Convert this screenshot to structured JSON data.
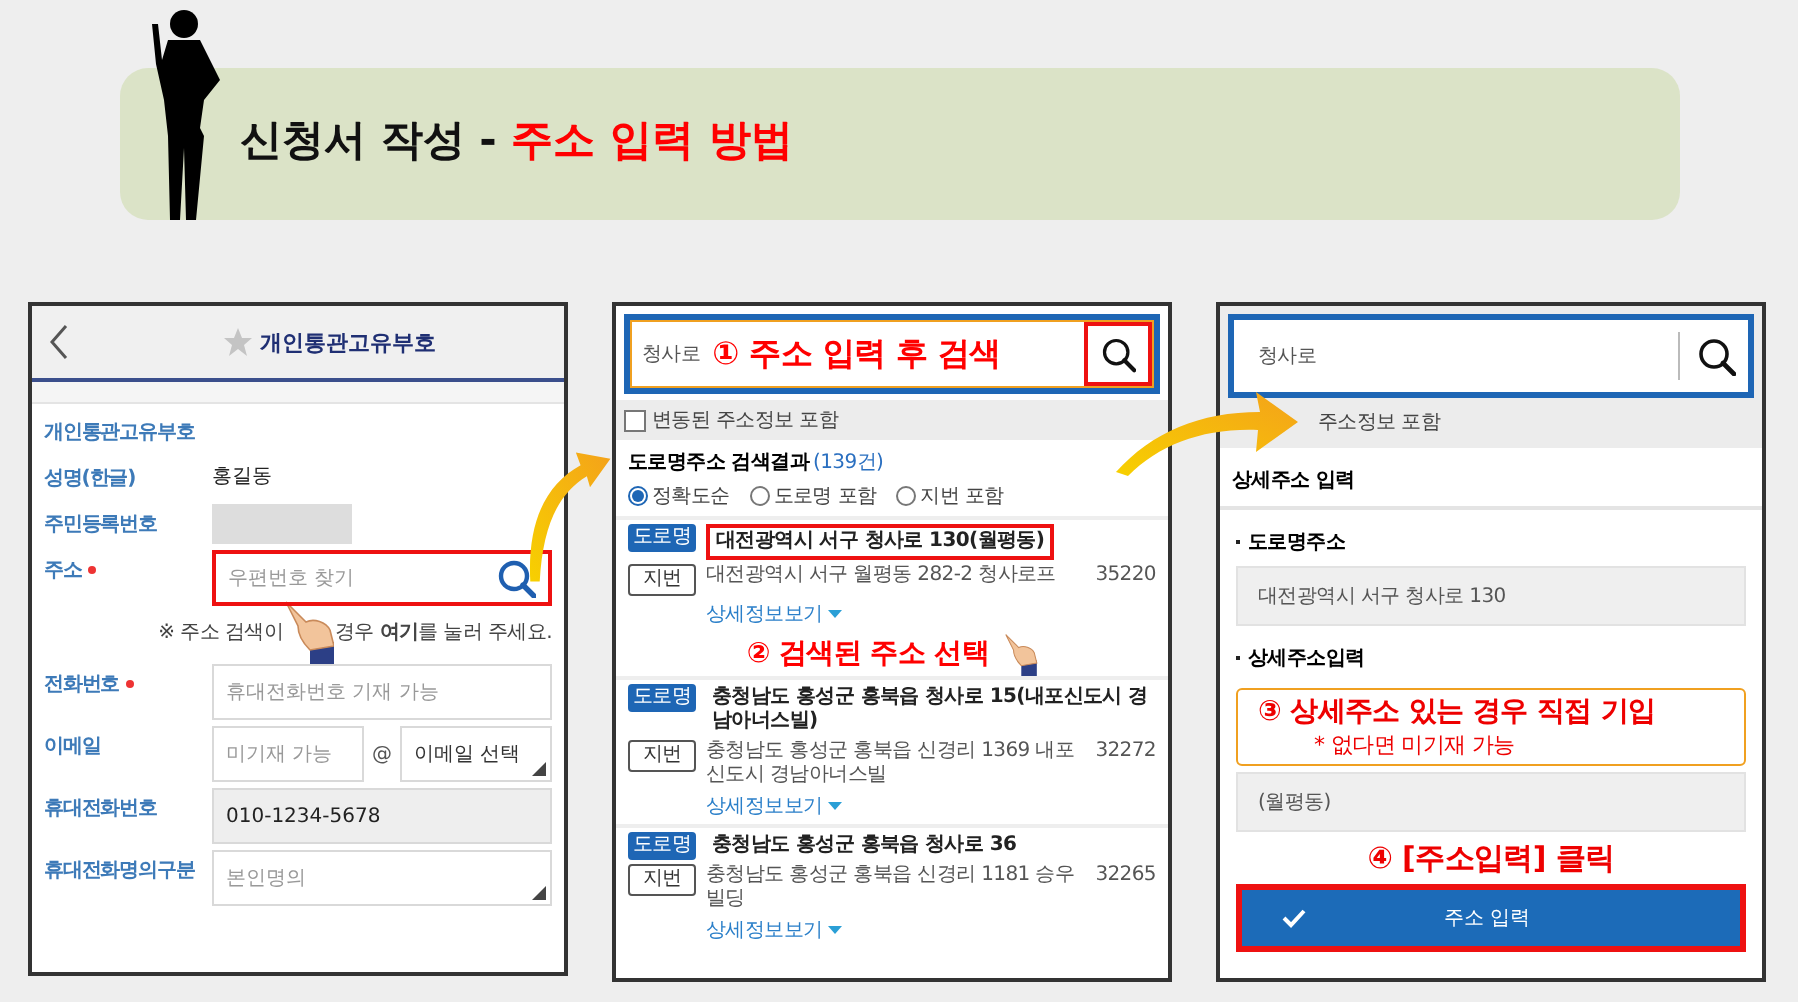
{
  "title": {
    "text": "신청서 작성 - ",
    "highlight": "주소 입력 방법"
  },
  "panel_1": {
    "header": {
      "title": "개인통관고유부호"
    },
    "fields": [
      {
        "kind": "heading",
        "label": "개인통관고유부호",
        "required": false
      },
      {
        "kind": "text",
        "label": "성명(한글)",
        "required": false,
        "value": "홍길동"
      },
      {
        "kind": "masked",
        "label": "주민등록번호",
        "required": false
      },
      {
        "kind": "search",
        "label": "주소",
        "required": true,
        "placeholder": "우편번호 찾기",
        "highlighted": true,
        "note_start": "※  주소 검색이",
        "note_end": "경우 **여기**를 눌러 주세요."
      },
      {
        "kind": "input",
        "label": "전화번호",
        "required": true,
        "placeholder": "휴대전화번호 기재 가능"
      },
      {
        "kind": "email",
        "label": "이메일",
        "required": false,
        "placeholder": "미기재 가능",
        "separator": "@",
        "select": "이메일 선택"
      },
      {
        "kind": "readonly",
        "label": "휴대전화번호",
        "required": false,
        "value": "010-1234-5678"
      },
      {
        "kind": "select",
        "label": "휴대전화명의구분",
        "required": false,
        "placeholder": "본인명의"
      }
    ]
  },
  "panel_2": {
    "search": {
      "value": "청사로",
      "callout": "① 주소 입력 후 검색",
      "button_highlighted": true
    },
    "option": {
      "label": "변동된 주소정보 포함",
      "checked": false
    },
    "results_title": "도로명주소 검색결과",
    "results_count": "(139건)",
    "sort": [
      {
        "label": "정확도순",
        "selected": true
      },
      {
        "label": "도로명 포함",
        "selected": false
      },
      {
        "label": "지번 포함",
        "selected": false
      }
    ],
    "results": [
      {
        "road_label": "도로명",
        "road": "대전광역시 서구 청사로 130(월평동)",
        "lot_label": "지번",
        "lot": "대전광역시 서구 월평동 282-2 청사로프",
        "zip": "35220",
        "detail": "상세정보보기",
        "highlighted": true,
        "callout": "② 검색된 주소 선택"
      },
      {
        "road_label": "도로명",
        "road": "충청남도 홍성군 홍북읍 청사로 15(내포신도시 경남아너스빌)",
        "lot_label": "지번",
        "lot": "충청남도 홍성군 홍북읍 신경리 1369 내포신도시 경남아너스빌",
        "zip": "32272",
        "detail": "상세정보보기",
        "highlighted": false
      },
      {
        "road_label": "도로명",
        "road": "충청남도 홍성군 홍북읍 청사로 36",
        "lot_label": "지번",
        "lot": "충청남도 홍성군 홍북읍 신경리 1181 승우빌딩",
        "zip": "32265",
        "detail": "상세정보보기",
        "highlighted": false
      }
    ]
  },
  "panel_3": {
    "search": {
      "value": "청사로"
    },
    "option_label": "주소정보 포함",
    "section_title": "상세주소 입력",
    "road": {
      "label": "도로명주소",
      "value": "대전광역시 서구 청사로 130"
    },
    "detail": {
      "label": "상세주소입력",
      "callout": "③ 상세주소 있는 경우 직접 기입",
      "callout_note": "* 없다면 미기재 가능",
      "value": "(월평동)"
    },
    "submit": {
      "callout": "④ [주소입력] 클릭",
      "label": "주소 입력",
      "highlighted": true
    }
  }
}
